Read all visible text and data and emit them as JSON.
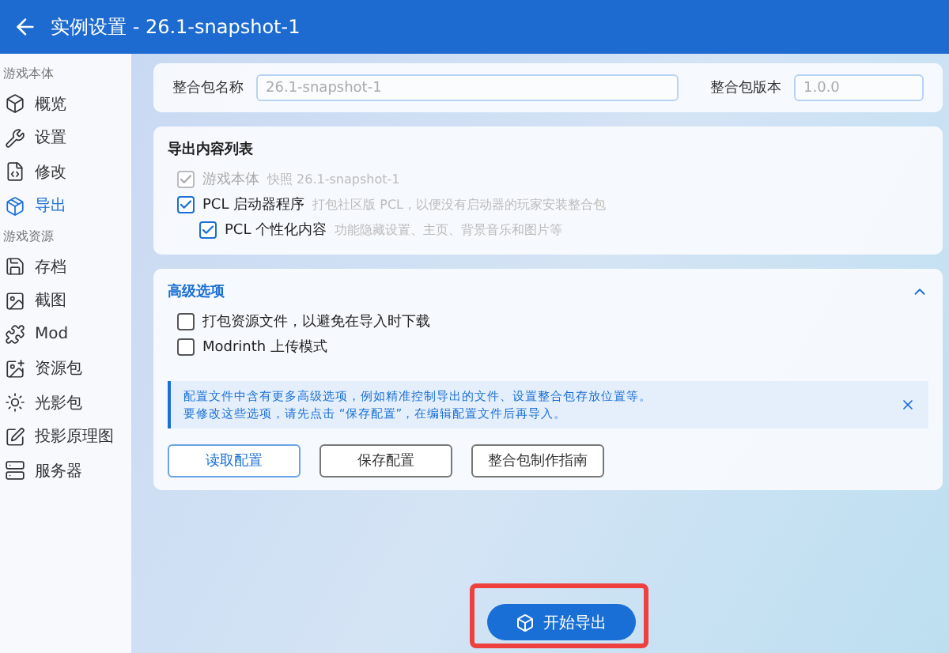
{
  "window": {
    "title": "实例设置 - 26.1-snapshot-1"
  },
  "sidebar": {
    "sections": [
      {
        "label": "游戏本体",
        "items": [
          {
            "label": "概览",
            "selected": false
          },
          {
            "label": "设置",
            "selected": false
          },
          {
            "label": "修改",
            "selected": false
          },
          {
            "label": "导出",
            "selected": true
          }
        ]
      },
      {
        "label": "游戏资源",
        "items": [
          {
            "label": "存档",
            "selected": false
          },
          {
            "label": "截图",
            "selected": false
          },
          {
            "label": "Mod",
            "selected": false
          },
          {
            "label": "资源包",
            "selected": false
          },
          {
            "label": "光影包",
            "selected": false
          },
          {
            "label": "投影原理图",
            "selected": false
          },
          {
            "label": "服务器",
            "selected": false
          }
        ]
      }
    ]
  },
  "pack_info": {
    "name_label": "整合包名称",
    "name_value": "26.1-snapshot-1",
    "version_label": "整合包版本",
    "version_value": "1.0.0"
  },
  "export_list": {
    "title": "导出内容列表",
    "items": [
      {
        "label": "游戏本体",
        "description": "快照 26.1-snapshot-1",
        "checked": true,
        "disabled": true
      },
      {
        "label": "PCL 启动器程序",
        "description": "打包社区版 PCL，以便没有启动器的玩家安装整合包",
        "checked": true,
        "disabled": false,
        "children": [
          {
            "label": "PCL 个性化内容",
            "description": "功能隐藏设置、主页、背景音乐和图片等",
            "checked": true,
            "disabled": false
          }
        ]
      }
    ]
  },
  "advanced": {
    "title": "高级选项",
    "expanded": true,
    "options": [
      {
        "label": "打包资源文件，以避免在导入时下载",
        "checked": false
      },
      {
        "label": "Modrinth 上传模式",
        "checked": false
      }
    ],
    "notice": {
      "lines": [
        "配置文件中含有更多高级选项，例如精准控制导出的文件、设置整合包存放位置等。",
        "要修改这些选项，请先点击 “保存配置”，在编辑配置文件后再导入。"
      ]
    },
    "buttons": [
      {
        "label": "读取配置",
        "kind": "primary"
      },
      {
        "label": "保存配置",
        "kind": "default"
      },
      {
        "label": "整合包制作指南",
        "kind": "default"
      }
    ]
  },
  "start_button": {
    "label": "开始导出"
  }
}
